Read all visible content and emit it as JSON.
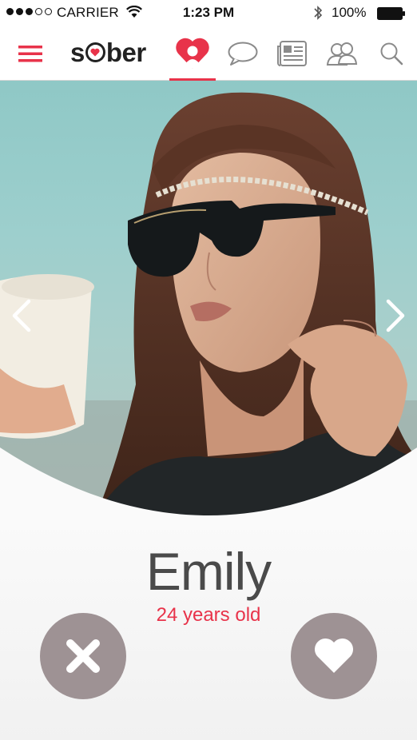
{
  "status_bar": {
    "carrier": "CARRIER",
    "time": "1:23 PM",
    "battery": "100%",
    "icons": [
      "signal-dots",
      "wifi-icon",
      "bluetooth-icon",
      "battery-icon"
    ]
  },
  "nav": {
    "app_name": "sober",
    "active_tab": "match",
    "tabs": [
      "menu-icon",
      "match-heart-icon",
      "chat-icon",
      "news-icon",
      "friends-icon",
      "search-icon"
    ],
    "accent_color": "#e8334a"
  },
  "profile": {
    "name": "Emily",
    "age": "24 years old"
  },
  "actions": {
    "dislike_icon": "x-icon",
    "like_icon": "heart-icon",
    "button_color": "#9e9294"
  }
}
